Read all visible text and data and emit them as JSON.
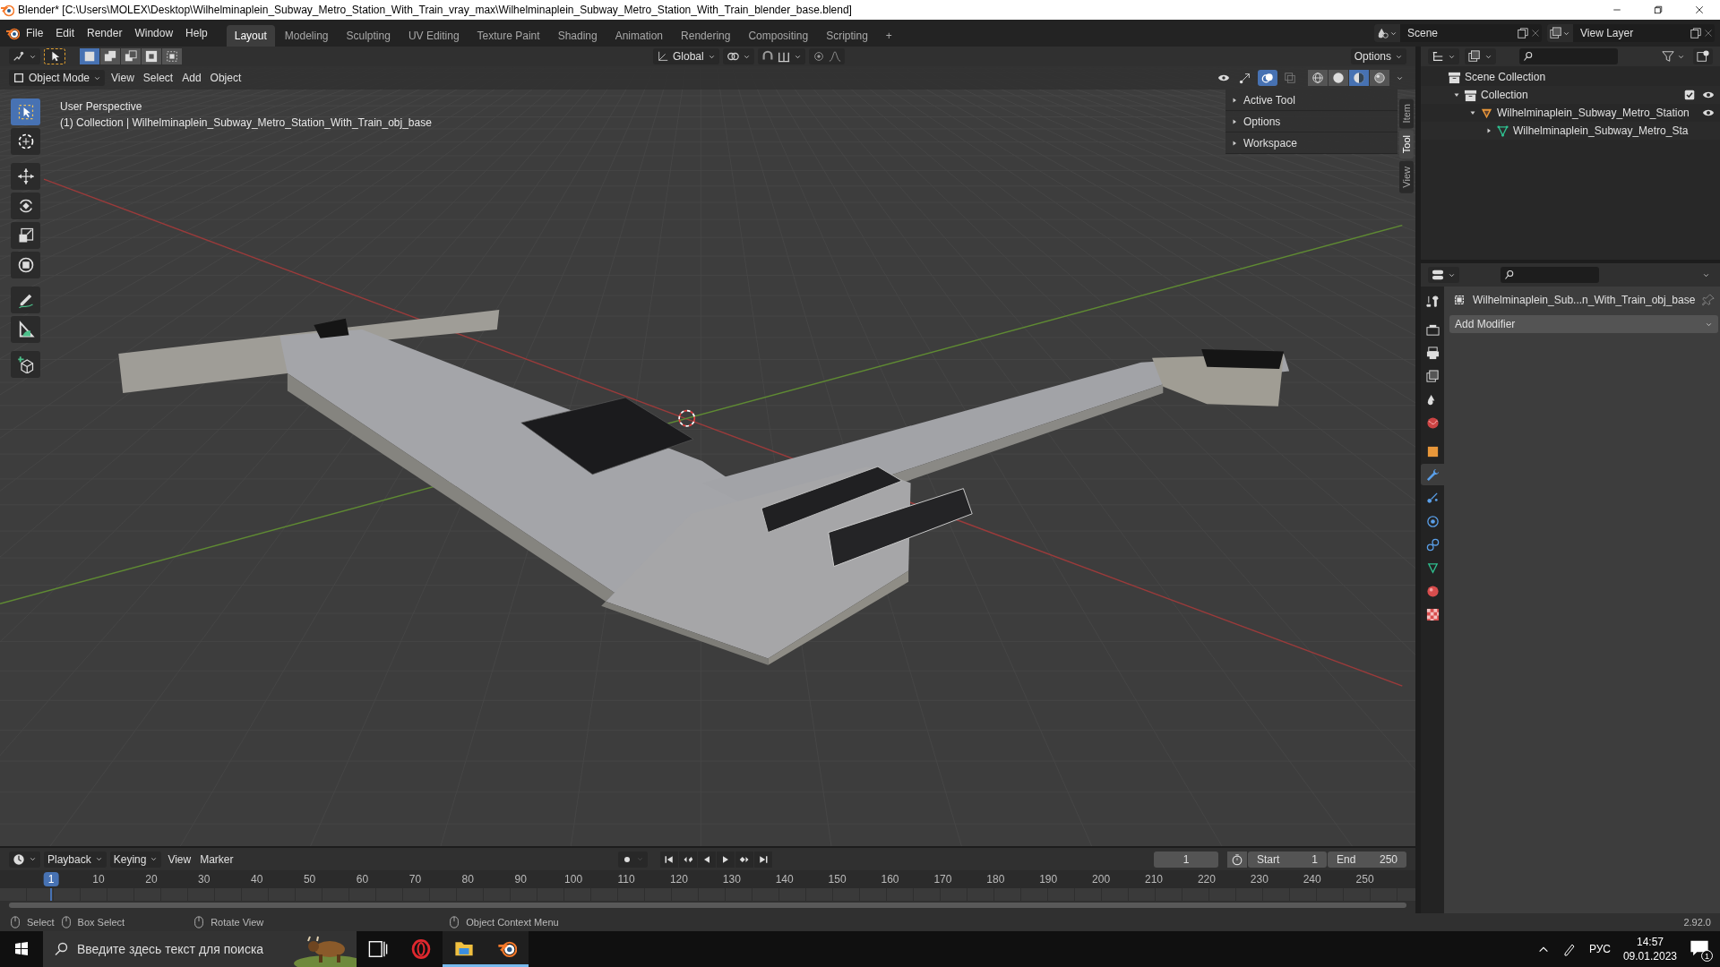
{
  "window": {
    "title": "Blender* [C:\\Users\\MOLEX\\Desktop\\Wilhelminaplein_Subway_Metro_Station_With_Train_vray_max\\Wilhelminaplein_Subway_Metro_Station_With_Train_blender_base.blend]"
  },
  "menu": [
    "File",
    "Edit",
    "Render",
    "Window",
    "Help"
  ],
  "workspaces": [
    {
      "label": "Layout",
      "selected": true
    },
    {
      "label": "Modeling",
      "selected": false
    },
    {
      "label": "Sculpting",
      "selected": false
    },
    {
      "label": "UV Editing",
      "selected": false
    },
    {
      "label": "Texture Paint",
      "selected": false
    },
    {
      "label": "Shading",
      "selected": false
    },
    {
      "label": "Animation",
      "selected": false
    },
    {
      "label": "Rendering",
      "selected": false
    },
    {
      "label": "Compositing",
      "selected": false
    },
    {
      "label": "Scripting",
      "selected": false
    }
  ],
  "add_workspace": "+",
  "scene": "Scene",
  "view_layer": "View Layer",
  "tool_header": {
    "select_modes": [
      {
        "kind": "new",
        "selected": true
      },
      {
        "kind": "extend",
        "selected": false
      },
      {
        "kind": "subtract",
        "selected": false
      },
      {
        "kind": "invert",
        "selected": false
      },
      {
        "kind": "intersect",
        "selected": false
      }
    ],
    "orientation": "Global",
    "options": "Options"
  },
  "viewport_header": {
    "mode": "Object Mode",
    "menus": [
      "View",
      "Select",
      "Add",
      "Object"
    ],
    "overlays": true,
    "shading": [
      {
        "kind": "wireframe",
        "selected": false
      },
      {
        "kind": "solid",
        "selected": false
      },
      {
        "kind": "material",
        "selected": true
      },
      {
        "kind": "rendered",
        "selected": false
      }
    ]
  },
  "toolbar": [
    {
      "kind": "select",
      "selected": true
    },
    {
      "kind": "cursor",
      "selected": false
    },
    {
      "kind": "move",
      "selected": false
    },
    {
      "kind": "rotate",
      "selected": false
    },
    {
      "kind": "scale",
      "selected": false
    },
    {
      "kind": "transform",
      "selected": false
    },
    {
      "kind": "annotate",
      "selected": false
    },
    {
      "kind": "measure",
      "selected": false
    },
    {
      "kind": "add_cube",
      "selected": false
    }
  ],
  "viewport": {
    "view_name": "User Perspective",
    "object_info": "(1) Collection | Wilhelminaplein_Subway_Metro_Station_With_Train_obj_base"
  },
  "sidebar": {
    "panels": [
      {
        "label": "Active Tool",
        "expanded": false
      },
      {
        "label": "Options",
        "expanded": false
      },
      {
        "label": "Workspace",
        "expanded": false
      }
    ],
    "tabs": [
      {
        "label": "Item",
        "selected": false
      },
      {
        "label": "Tool",
        "selected": true
      },
      {
        "label": "View",
        "selected": false
      }
    ]
  },
  "outliner": {
    "items": [
      {
        "label": "Scene Collection",
        "kind": "scene",
        "children": [
          {
            "label": "Collection",
            "kind": "collection",
            "expanded": true,
            "checked": true,
            "visible": true,
            "children": [
              {
                "label": "Wilhelminaplein_Subway_Metro_Station",
                "kind": "object",
                "expanded": true,
                "visible": true,
                "children": [
                  {
                    "label": "Wilhelminaplein_Subway_Metro_Sta",
                    "kind": "mesh",
                    "expanded": false
                  }
                ]
              }
            ]
          }
        ]
      }
    ]
  },
  "properties": {
    "object_name": "Wilhelminaplein_Sub...n_With_Train_obj_base",
    "add_modifier": "Add Modifier",
    "tabs": [
      {
        "kind": "tool",
        "selected": false
      },
      {
        "kind": "render",
        "selected": false
      },
      {
        "kind": "output",
        "selected": false
      },
      {
        "kind": "view_layer",
        "selected": false
      },
      {
        "kind": "scene",
        "selected": false
      },
      {
        "kind": "world",
        "selected": false
      },
      {
        "kind": "object",
        "selected": false
      },
      {
        "kind": "modifiers",
        "selected": true
      },
      {
        "kind": "particles",
        "selected": false
      },
      {
        "kind": "physics",
        "selected": false
      },
      {
        "kind": "constraints",
        "selected": false
      },
      {
        "kind": "data",
        "selected": false
      },
      {
        "kind": "material",
        "selected": false
      },
      {
        "kind": "texture",
        "selected": false
      }
    ]
  },
  "timeline": {
    "menus": [
      "Playback",
      "Keying",
      "View",
      "Marker"
    ],
    "current_frame": "1",
    "start_label": "Start",
    "start": "1",
    "end_label": "End",
    "end": "250",
    "playhead": "1",
    "ticks": [
      "10",
      "20",
      "30",
      "40",
      "50",
      "60",
      "70",
      "80",
      "90",
      "100",
      "110",
      "120",
      "130",
      "140",
      "150",
      "160",
      "170",
      "180",
      "190",
      "200",
      "210",
      "220",
      "230",
      "240",
      "250"
    ]
  },
  "status_bar": {
    "hints": [
      "Select",
      "Box Select",
      "Rotate View",
      "Object Context Menu"
    ],
    "version": "2.92.0"
  },
  "taskbar": {
    "search_placeholder": "Введите здесь текст для поиска",
    "apps": [
      {
        "kind": "task_view",
        "active": false
      },
      {
        "kind": "opera",
        "active": false
      },
      {
        "kind": "explorer",
        "active": true
      },
      {
        "kind": "blender",
        "active": true
      }
    ],
    "language": "РУС",
    "time": "14:57",
    "date": "09.01.2023",
    "notifications": "1"
  }
}
